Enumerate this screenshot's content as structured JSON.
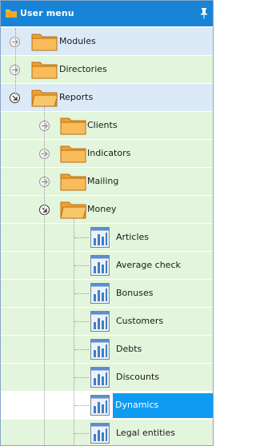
{
  "header": {
    "title": "User menu",
    "pin_icon": "pin-icon",
    "menu_icon": "folder-small-icon"
  },
  "colors": {
    "header": "#1784d6",
    "row_blue": "#dceaf7",
    "row_green": "#e3f5dc",
    "selected": "#0f9bf2"
  },
  "tree": [
    {
      "label": "Modules",
      "level": 0,
      "type": "folder",
      "state": "collapsed"
    },
    {
      "label": "Directories",
      "level": 0,
      "type": "folder",
      "state": "collapsed"
    },
    {
      "label": "Reports",
      "level": 0,
      "type": "folder",
      "state": "expanded"
    },
    {
      "label": "Clients",
      "level": 1,
      "type": "folder",
      "state": "collapsed"
    },
    {
      "label": "Indicators",
      "level": 1,
      "type": "folder",
      "state": "collapsed"
    },
    {
      "label": "Mailing",
      "level": 1,
      "type": "folder",
      "state": "collapsed"
    },
    {
      "label": "Money",
      "level": 1,
      "type": "folder",
      "state": "expanded"
    },
    {
      "label": "Articles",
      "level": 2,
      "type": "report"
    },
    {
      "label": "Average check",
      "level": 2,
      "type": "report"
    },
    {
      "label": "Bonuses",
      "level": 2,
      "type": "report"
    },
    {
      "label": "Customers",
      "level": 2,
      "type": "report"
    },
    {
      "label": "Debts",
      "level": 2,
      "type": "report"
    },
    {
      "label": "Discounts",
      "level": 2,
      "type": "report"
    },
    {
      "label": "Dynamics",
      "level": 2,
      "type": "report",
      "selected": true
    },
    {
      "label": "Legal entities",
      "level": 2,
      "type": "report"
    }
  ]
}
